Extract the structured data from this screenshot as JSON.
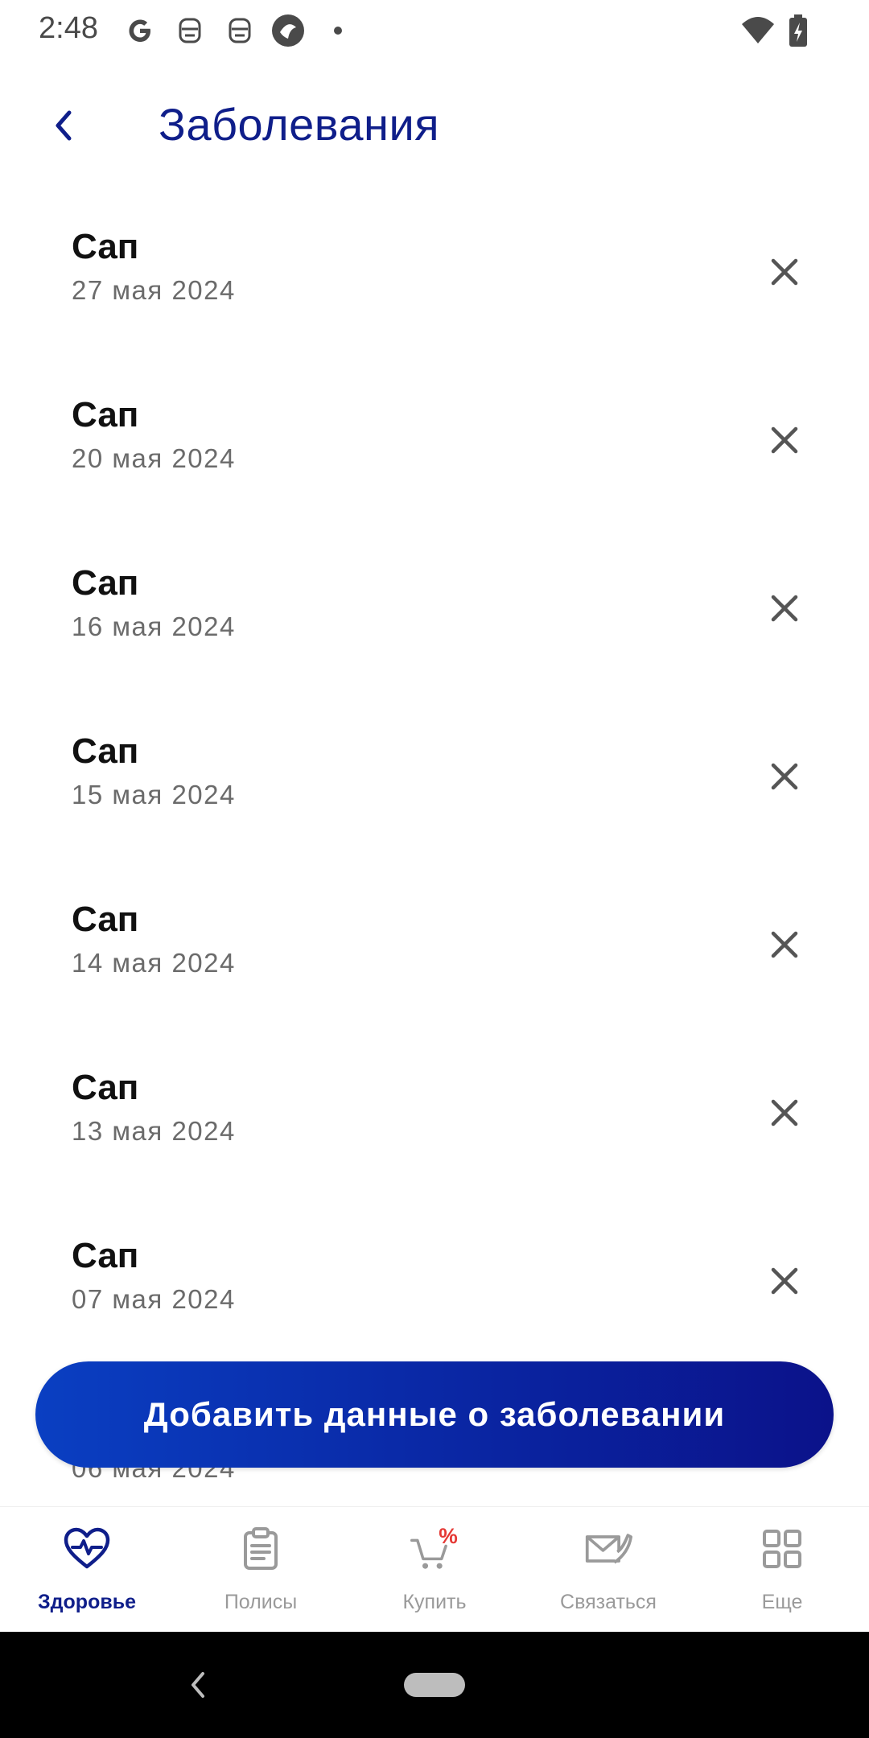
{
  "status_bar": {
    "time": "2:48",
    "icons": [
      "google-icon",
      "bot-icon",
      "bot-icon",
      "shield-app-icon",
      "dot-icon",
      "wifi-icon",
      "battery-charging-icon"
    ]
  },
  "header": {
    "title": "Заболевания",
    "back_icon": "chevron-left-icon"
  },
  "diseases": [
    {
      "name": "Сап",
      "date": "27 мая 2024"
    },
    {
      "name": "Сап",
      "date": "20 мая 2024"
    },
    {
      "name": "Сап",
      "date": "16 мая 2024"
    },
    {
      "name": "Сап",
      "date": "15 мая 2024"
    },
    {
      "name": "Сап",
      "date": "14 мая 2024"
    },
    {
      "name": "Сап",
      "date": "13 мая 2024"
    },
    {
      "name": "Сап",
      "date": "07 мая 2024"
    }
  ],
  "partial_item": {
    "date": "06 мая 2024"
  },
  "add_button": {
    "label": "Добавить данные о заболевании"
  },
  "bottom_nav": [
    {
      "label": "Здоровье",
      "icon": "heart-pulse-icon",
      "active": true
    },
    {
      "label": "Полисы",
      "icon": "clipboard-icon",
      "active": false
    },
    {
      "label": "Купить",
      "icon": "cart-percent-icon",
      "active": false
    },
    {
      "label": "Связаться",
      "icon": "envelope-phone-icon",
      "active": false
    },
    {
      "label": "Еще",
      "icon": "grid-icon",
      "active": false
    }
  ],
  "colors": {
    "brand_dark": "#0f1e8a",
    "button_gradient_start": "#0a3fc2",
    "button_gradient_end": "#0b128a",
    "promo_red": "#e53935",
    "inactive_gray": "#9a9a9a"
  }
}
